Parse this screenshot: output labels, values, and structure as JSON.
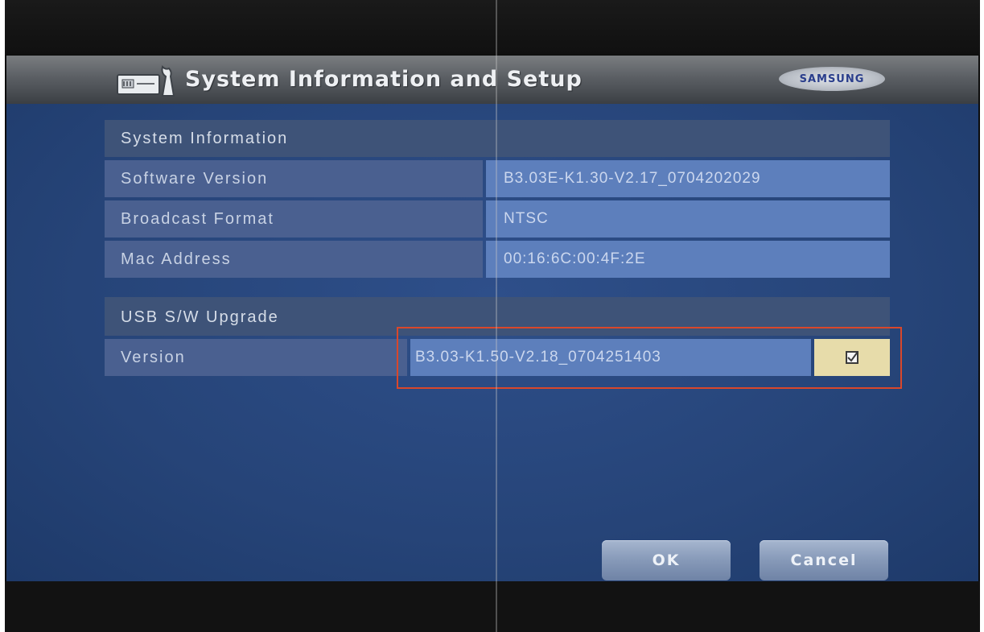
{
  "header": {
    "title": "System Information and Setup",
    "logo_text": "SAMSUNG",
    "icon": "setup-tools-icon"
  },
  "system_info": {
    "heading": "System Information",
    "rows": [
      {
        "label": "Software Version",
        "value": "B3.03E-K1.30-V2.17_0704202029"
      },
      {
        "label": "Broadcast Format",
        "value": "NTSC"
      },
      {
        "label": "Mac Address",
        "value": "00:16:6C:00:4F:2E"
      }
    ]
  },
  "usb_upgrade": {
    "heading": "USB S/W Upgrade",
    "label": "Version",
    "value": "B3.03-K1.50-V2.18_0704251403",
    "checked": true
  },
  "buttons": {
    "ok": "OK",
    "cancel": "Cancel"
  },
  "colors": {
    "panel": "#264478",
    "value_cell": "#5d7fbc",
    "checkbox_cell": "#e7dcaa",
    "highlight": "#d9472b"
  }
}
